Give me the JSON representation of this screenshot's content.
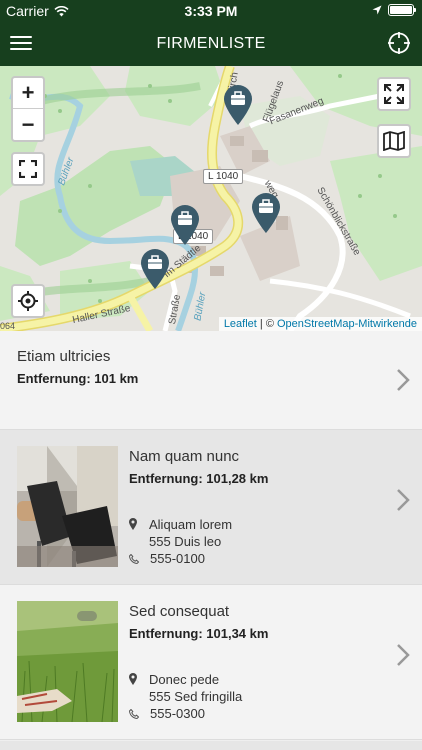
{
  "status": {
    "carrier": "Carrier",
    "time": "3:33 PM"
  },
  "nav": {
    "title": "FIRMENLISTE"
  },
  "map": {
    "labels": {
      "road_badge": "L 1040",
      "road_badge_2": "L 1040",
      "haller": "Haller Straße",
      "fasanenweg": "Fasanenweg",
      "schoenblick": "Schönblickstraße",
      "buehler": "Bühler",
      "buehler2": "Bühler",
      "stadtle": "Im Städtle",
      "strasse": "Straße",
      "kirch": "Kirch",
      "roadnum": "064",
      "weg": "weg",
      "flugel": "Flügelaus"
    },
    "attribution": {
      "leaflet": "Leaflet",
      "sep": " | © ",
      "osm": "OpenStreetMap-Mitwirkende"
    }
  },
  "items": [
    {
      "name": "Etiam ultricies",
      "distance": "Entfernung: 101 km"
    },
    {
      "name": "Nam quam nunc",
      "distance": "Entfernung: 101,28 km",
      "address1": "Aliquam lorem",
      "address2": "555 Duis leo",
      "phone": "555-0100"
    },
    {
      "name": "Sed consequat",
      "distance": "Entfernung: 101,34 km",
      "address1": "Donec pede",
      "address2": "555 Sed fringilla",
      "phone": "555-0300"
    }
  ],
  "colors": {
    "nav": "#173f1e",
    "pin": "#3b5b6b",
    "road": "#f6f3a6",
    "river": "#a6d1e0"
  }
}
